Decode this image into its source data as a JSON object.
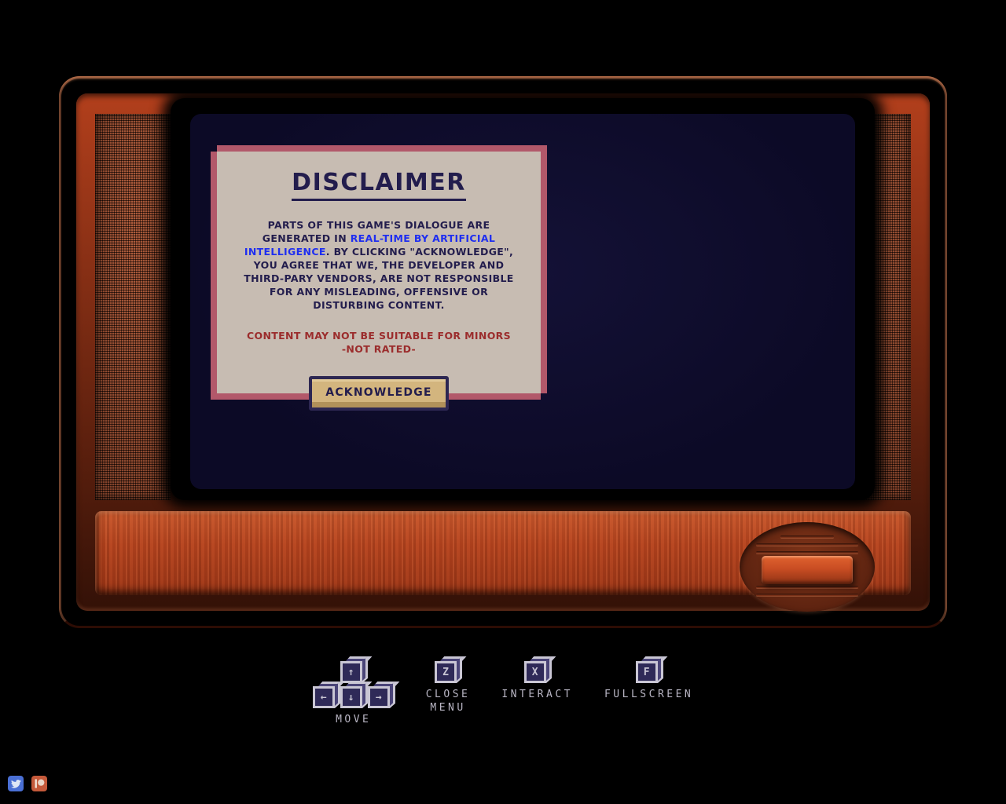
{
  "window": {
    "background_color": "#000000"
  },
  "tv": {
    "name": "retro-television-cabinet",
    "wood_color": "#b8411d",
    "grille_color": "#8e3b22",
    "screen_color": "#0c0a26",
    "dial": {
      "name": "volume-dial",
      "slider_color": "#c94d23"
    }
  },
  "dialog": {
    "title": "DISCLAIMER",
    "border_color": "#b2586a",
    "panel_color": "#c7bcb2",
    "text_color": "#231d4d",
    "body": {
      "segment_1": "PARTS OF THIS GAME'S DIALOGUE ARE GENERATED IN ",
      "highlight": "REAL-TIME BY ARTIFICIAL INTELLIGENCE",
      "segment_2": ". BY CLICKING \"ACKNOWLEDGE\", YOU AGREE THAT WE, THE DEVELOPER AND THIRD-PARY VENDORS, ARE NOT RESPONSIBLE FOR ANY MISLEADING, OFFENSIVE OR DISTURBING CONTENT.",
      "highlight_color": "#1f2ef0"
    },
    "warning": {
      "line_1": "CONTENT MAY NOT BE SUITABLE FOR MINORS",
      "line_2": "-NOT RATED-",
      "color": "#9b2c2c"
    },
    "acknowledge_button": {
      "label": "ACKNOWLEDGE",
      "fill_color": "#d3b57e",
      "border_color": "#2d2752"
    }
  },
  "hints": [
    {
      "name": "move",
      "label": "MOVE",
      "keys": [
        "↑",
        "←",
        "↓",
        "→"
      ],
      "type": "arrows"
    },
    {
      "name": "close-menu",
      "label": "CLOSE\nMENU",
      "label_line_1": "CLOSE",
      "label_line_2": "MENU",
      "key": "Z",
      "type": "single"
    },
    {
      "name": "interact",
      "label": "INTERACT",
      "key": "X",
      "type": "single"
    },
    {
      "name": "fullscreen",
      "label": "FULLSCREEN",
      "key": "F",
      "type": "single"
    }
  ],
  "social": [
    {
      "name": "twitter",
      "glyph": "•",
      "color": "#4a6fd4"
    },
    {
      "name": "patreon",
      "glyph": "•",
      "color": "#c4593a"
    }
  ]
}
